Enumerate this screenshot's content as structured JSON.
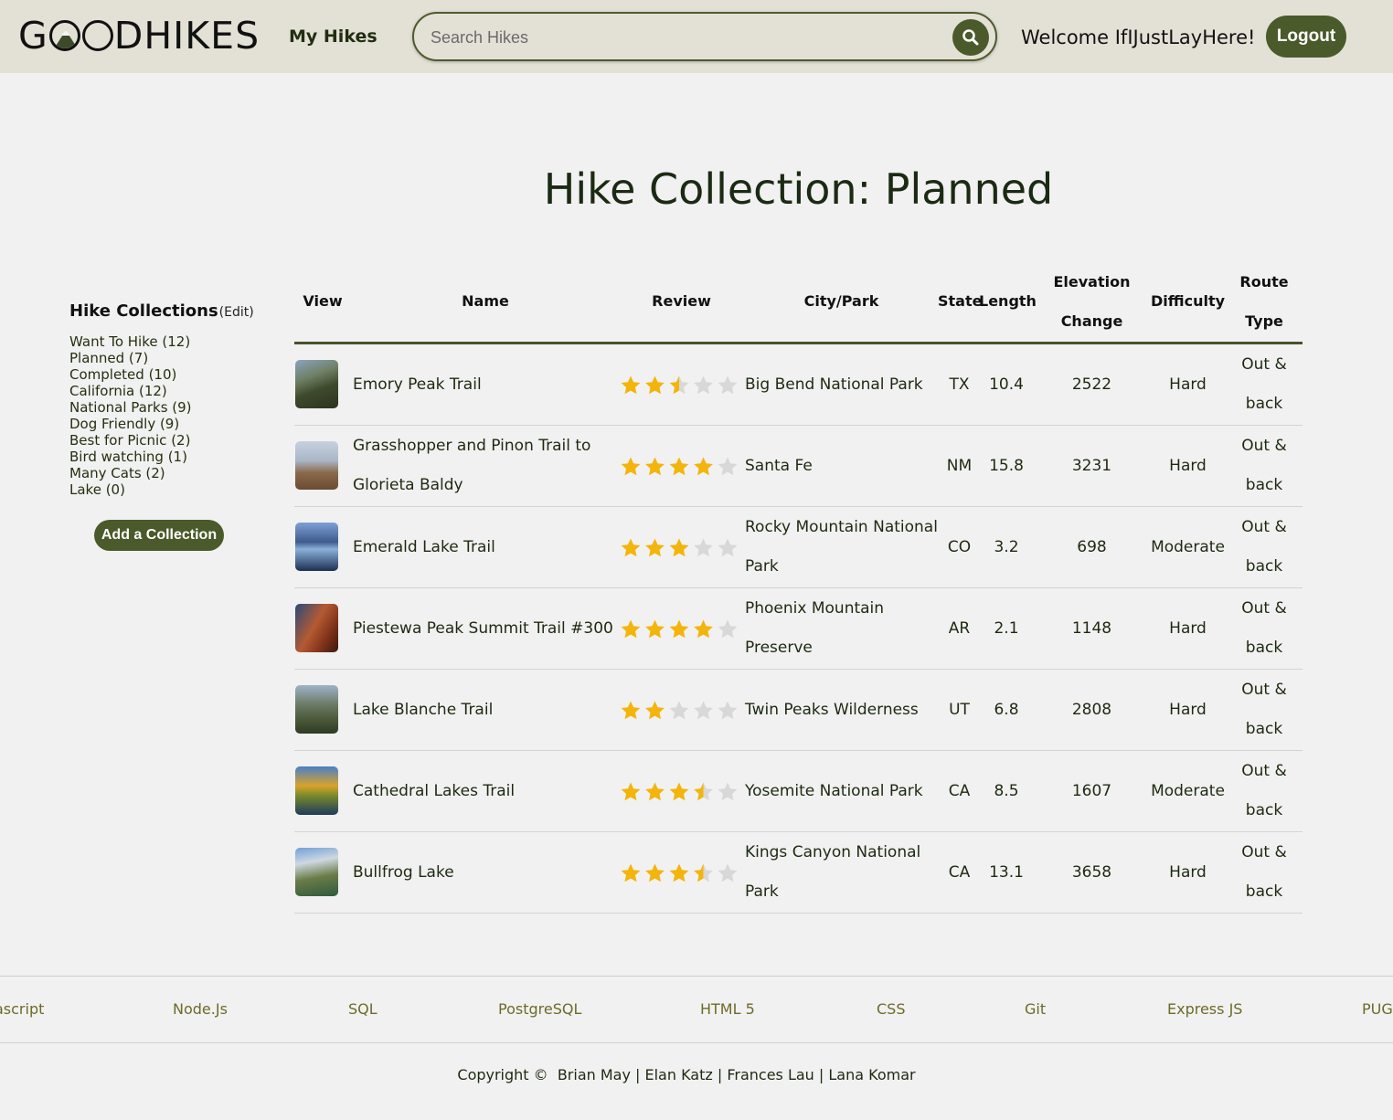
{
  "header": {
    "logo_text": "GOODHIKES",
    "my_hikes": "My Hikes",
    "search_placeholder": "Search Hikes",
    "welcome": "Welcome IfIJustLayHere!",
    "logout": "Logout",
    "accent_color": "#4a5a2a"
  },
  "page_title": "Hike Collection: Planned",
  "sidebar": {
    "title": "Hike Collections",
    "edit": "(Edit)",
    "collections": [
      "Want To Hike (12)",
      "Planned (7)",
      "Completed (10)",
      "California (12)",
      "National Parks (9)",
      "Dog Friendly (9)",
      "Best for Picnic (2)",
      "Bird watching (1)",
      "Many Cats (2)",
      "Lake (0)"
    ],
    "add_button": "Add a Collection"
  },
  "table": {
    "headers": {
      "view": "View",
      "name": "Name",
      "review": "Review",
      "city": "City/Park",
      "state": "State",
      "length": "Length",
      "elev1": "Elevation",
      "elev2": "Change",
      "difficulty": "Difficulty",
      "route1": "Route",
      "route2": "Type"
    },
    "rows": [
      {
        "name": "Emory Peak Trail",
        "name2": "",
        "rating": 2.5,
        "city": "Big Bend National Park",
        "city2": "",
        "state": "TX",
        "length": "10.4",
        "elevation": "2522",
        "difficulty": "Hard",
        "route1": "Out &",
        "route2": "back"
      },
      {
        "name": "Grasshopper and Pinon Trail to",
        "name2": "Glorieta Baldy",
        "rating": 4,
        "city": "Santa Fe",
        "city2": "",
        "state": "NM",
        "length": "15.8",
        "elevation": "3231",
        "difficulty": "Hard",
        "route1": "Out &",
        "route2": "back"
      },
      {
        "name": "Emerald Lake Trail",
        "name2": "",
        "rating": 3,
        "city": "Rocky Mountain National",
        "city2": "Park",
        "state": "CO",
        "length": "3.2",
        "elevation": "698",
        "difficulty": "Moderate",
        "route1": "Out &",
        "route2": "back"
      },
      {
        "name": "Piestewa Peak Summit Trail #300",
        "name2": "",
        "rating": 4,
        "city": "Phoenix Mountain",
        "city2": "Preserve",
        "state": "AR",
        "length": "2.1",
        "elevation": "1148",
        "difficulty": "Hard",
        "route1": "Out &",
        "route2": "back"
      },
      {
        "name": "Lake Blanche Trail",
        "name2": "",
        "rating": 2,
        "city": "Twin Peaks Wilderness",
        "city2": "",
        "state": "UT",
        "length": "6.8",
        "elevation": "2808",
        "difficulty": "Hard",
        "route1": "Out &",
        "route2": "back"
      },
      {
        "name": "Cathedral Lakes Trail",
        "name2": "",
        "rating": 3.5,
        "city": "Yosemite National Park",
        "city2": "",
        "state": "CA",
        "length": "8.5",
        "elevation": "1607",
        "difficulty": "Moderate",
        "route1": "Out &",
        "route2": "back"
      },
      {
        "name": "Bullfrog Lake",
        "name2": "",
        "rating": 3.5,
        "city": "Kings Canyon National",
        "city2": "Park",
        "state": "CA",
        "length": "13.1",
        "elevation": "3658",
        "difficulty": "Hard",
        "route1": "Out &",
        "route2": "back"
      }
    ]
  },
  "footer": {
    "tech": [
      "Javascript",
      "Node.Js",
      "SQL",
      "PostgreSQL",
      "HTML 5",
      "CSS",
      "Git",
      "Express JS",
      "PUG"
    ],
    "copyright": "Copyright ©  Brian May | Elan Katz | Frances Lau | Lana Komar"
  }
}
